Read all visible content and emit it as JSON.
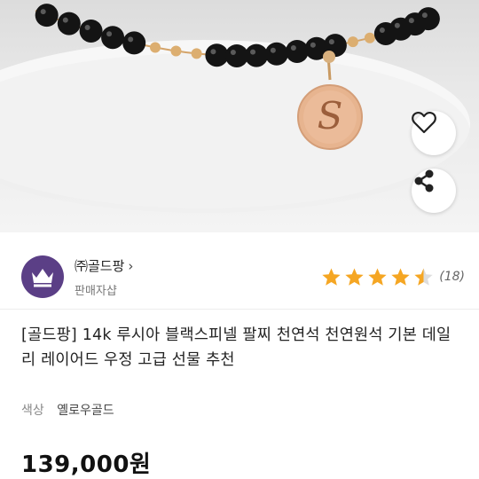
{
  "product_image": {
    "alt_icon": "bracelet-photo",
    "pendant_letter": "S"
  },
  "actions": {
    "wishlist_icon": "heart-outline-icon",
    "share_icon": "share-icon"
  },
  "seller": {
    "logo_icon": "crown-logo-icon",
    "name": "㈜골드팡",
    "chevron": "›",
    "subtitle": "판매자샵",
    "rating_value": 4.5,
    "rating_max": 5,
    "review_count": "(18)",
    "star_color": "#f5a623"
  },
  "product": {
    "title": "[골드팡] 14k 루시아 블랙스피넬 팔찌 천연석 천연원석 기본 데일리 레이어드 우정 고급 선물 추천",
    "option_label": "색상",
    "option_value": "옐로우골드",
    "price": "139,000원"
  },
  "colors": {
    "logo_bg": "#5b3f86"
  }
}
